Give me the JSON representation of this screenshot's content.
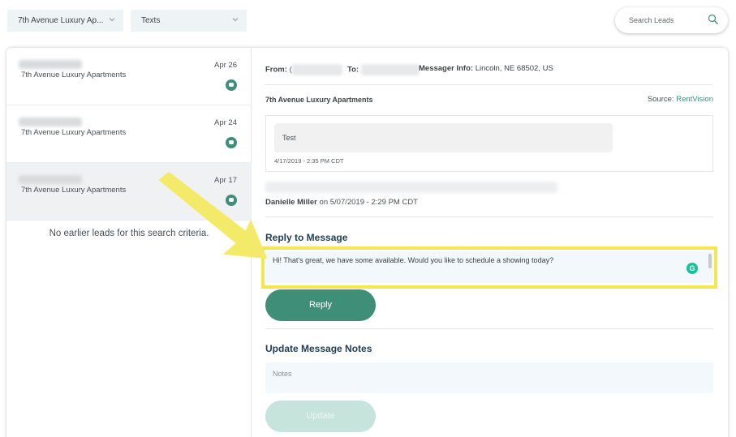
{
  "filters": {
    "community": "7th Avenue Luxury Ap...",
    "message_type": "Texts"
  },
  "search": {
    "placeholder": "Search Leads"
  },
  "leads": [
    {
      "community": "7th Avenue Luxury Apartments",
      "date": "Apr 26"
    },
    {
      "community": "7th Avenue Luxury Apartments",
      "date": "Apr 24"
    },
    {
      "community": "7th Avenue Luxury Apartments",
      "date": "Apr 17"
    }
  ],
  "no_leads_text": "No earlier leads for this search criteria.",
  "message": {
    "from_label": "From:",
    "from_prefix": "(",
    "to_label": "To:",
    "info_label": "Messager Info:",
    "info_value": "Lincoln, NE 68502, US",
    "community": "7th Avenue Luxury Apartments",
    "source_label": "Source:",
    "source_value": "RentVision",
    "body": "Test",
    "timestamp": "4/17/2019 - 2:35 PM CDT",
    "author": "Danielle Miller",
    "author_time": "on 5/07/2019 - 2:29 PM CDT"
  },
  "reply": {
    "title": "Reply to Message",
    "text": "Hi! That's great, we have some available. Would you like to schedule a showing today?",
    "button": "Reply"
  },
  "notes": {
    "title": "Update Message Notes",
    "placeholder": "Notes",
    "button": "Update"
  },
  "colors": {
    "accent": "#3f8f78",
    "highlight": "#f3e64e",
    "heading": "#1f3d53"
  }
}
